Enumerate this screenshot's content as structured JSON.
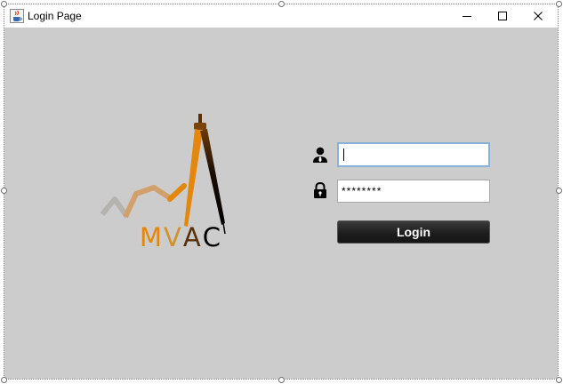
{
  "window": {
    "title": "Login Page",
    "icon": "java-cup-icon",
    "controls": [
      "minimize-icon",
      "maximize-icon",
      "close-icon"
    ]
  },
  "logo": {
    "letters": [
      "M",
      "V",
      "A",
      "C"
    ],
    "colors": {
      "gray": "#b5b3ae",
      "tan": "#d2a06a",
      "orange": "#e3870d",
      "brown": "#5a3008",
      "black": "#000000"
    }
  },
  "form": {
    "username": {
      "icon": "user-icon",
      "value": ""
    },
    "password": {
      "icon": "lock-icon",
      "value": "********"
    },
    "login_label": "Login"
  },
  "colors": {
    "background": "#cccccc",
    "titlebar": "#ffffff",
    "focus_border": "#8ab1d6",
    "button": "#1e1e1e"
  }
}
